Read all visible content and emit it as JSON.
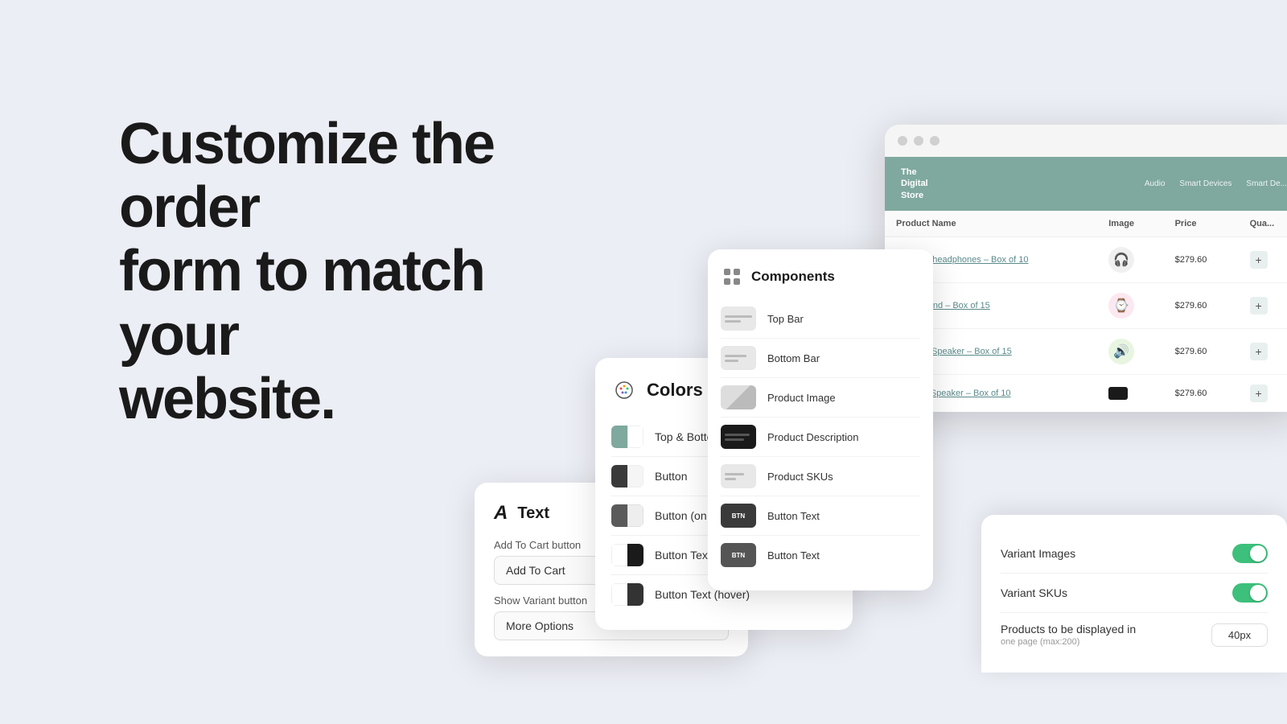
{
  "hero": {
    "line1": "Customize the order",
    "line2": "form to match your",
    "line3": "website."
  },
  "colors_panel": {
    "title": "Colors",
    "items": [
      {
        "label": "Top & Bottom Bar",
        "colors": [
          "#7fa89e",
          "#ffffff"
        ]
      },
      {
        "label": "Button",
        "colors": [
          "#3a3a3a",
          "#f5f5f5"
        ]
      },
      {
        "label": "Button (on hover)",
        "colors": [
          "#5a5a5a",
          "#eeeeee"
        ]
      },
      {
        "label": "Button Text",
        "colors": [
          "#ffffff",
          "#1a1a1a"
        ]
      },
      {
        "label": "Button Text (hover)",
        "colors": [
          "#ffffff",
          "#333333"
        ]
      }
    ]
  },
  "text_panel": {
    "title": "Text",
    "fields": [
      {
        "label": "Add To Cart button",
        "value": "Add To Cart"
      },
      {
        "label": "Show Variant button",
        "value": "More Options"
      }
    ]
  },
  "components_panel": {
    "title": "Components",
    "items": [
      {
        "label": "Top Bar"
      },
      {
        "label": "Bottom Bar"
      },
      {
        "label": "Product Image"
      },
      {
        "label": "Product Description"
      },
      {
        "label": "Product SKUs"
      },
      {
        "label": "Button Text"
      },
      {
        "label": "Button Text"
      }
    ]
  },
  "product_window": {
    "titlebar_dots": [
      "dot1",
      "dot2",
      "dot3"
    ],
    "store_name": "The\nDigital\nStore",
    "nav_items": [
      "Audio",
      "Smart Devices",
      "Smart De..."
    ],
    "table_headers": [
      "Product Name",
      "Image",
      "Price",
      "Qua..."
    ],
    "rows": [
      {
        "name": "Wireless headphones – Box of 10",
        "emoji": "🎧",
        "price": "$279.60",
        "bgcolor": "#f0f0f0"
      },
      {
        "name": "Smart Band – Box of 15",
        "emoji": "⌚",
        "price": "$279.60",
        "bgcolor": "#fce8f0"
      },
      {
        "name": "Portable Speaker – Box of 15",
        "emoji": "🔊",
        "price": "$279.60",
        "bgcolor": "#e8f5e0",
        "dot": true
      },
      {
        "name": "Outdoor Speaker – Box of 10",
        "emoji": "",
        "price": "$279.60",
        "bgcolor": "#1a1a1a",
        "swatch": true
      }
    ]
  },
  "settings_panel": {
    "rows": [
      {
        "label": "Variant Images",
        "sublabel": "",
        "type": "toggle",
        "value": true
      },
      {
        "label": "Variant SKUs",
        "sublabel": "",
        "type": "toggle",
        "value": true
      },
      {
        "label": "Products to be displayed in one page (max:200)",
        "sublabel": "",
        "type": "input",
        "value": "40px"
      }
    ]
  },
  "icons": {
    "palette": "🎨",
    "text_a": "A",
    "grid": "⊞"
  }
}
